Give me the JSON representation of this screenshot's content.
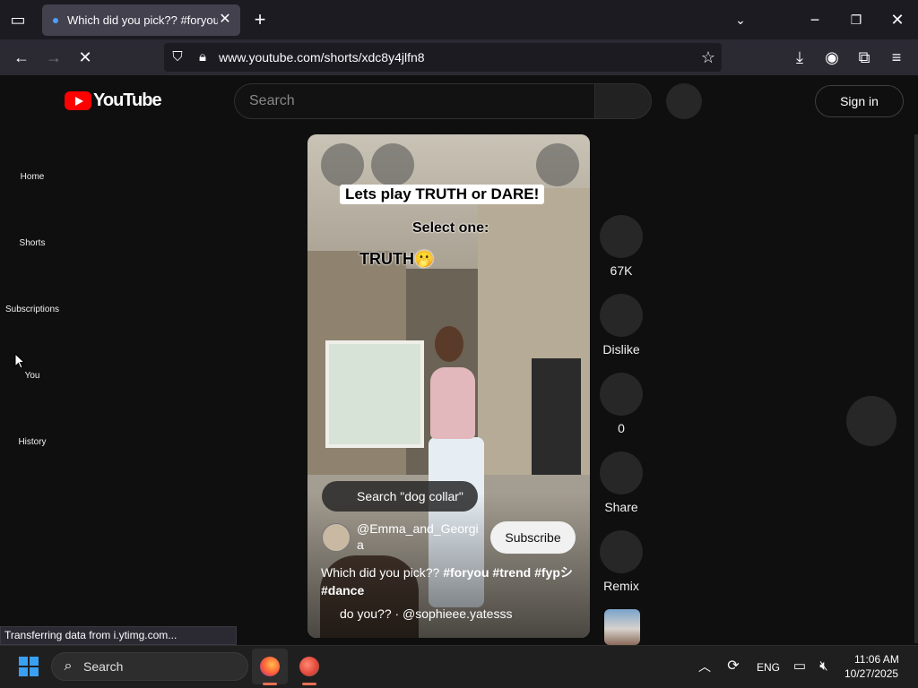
{
  "browser": {
    "tab_title": "Which did you pick?? #foryou #",
    "url": "www.youtube.com/shorts/xdc8y4jlfn8",
    "status_text": "Transferring data from i.ytimg.com..."
  },
  "youtube": {
    "logo_text": "YouTube",
    "search_placeholder": "Search",
    "sign_in_label": "Sign in",
    "guide": [
      {
        "label": "Home"
      },
      {
        "label": "Shorts"
      },
      {
        "label": "Subscriptions"
      },
      {
        "label": "You"
      },
      {
        "label": "History"
      }
    ]
  },
  "short": {
    "caption_title": "Lets play TRUTH or DARE!",
    "caption_select": "Select one:",
    "caption_choice": "TRUTH🫢",
    "search_chip": "Search \"dog collar\"",
    "channel": "@Emma_and_Georgia",
    "subscribe_label": "Subscribe",
    "description_lead": "Which did you pick?? ",
    "hashtags_line1": "#foryou #trend #fypシ",
    "hashtags_line2": "#dance",
    "music": "do you?? · @sophieee.yatesss"
  },
  "actions": {
    "like_count": "67K",
    "dislike_label": "Dislike",
    "comments_count": "0",
    "share_label": "Share",
    "remix_label": "Remix"
  },
  "taskbar": {
    "search_label": "Search",
    "language": "ENG",
    "time": "11:06 AM",
    "date": "10/27/2025"
  }
}
